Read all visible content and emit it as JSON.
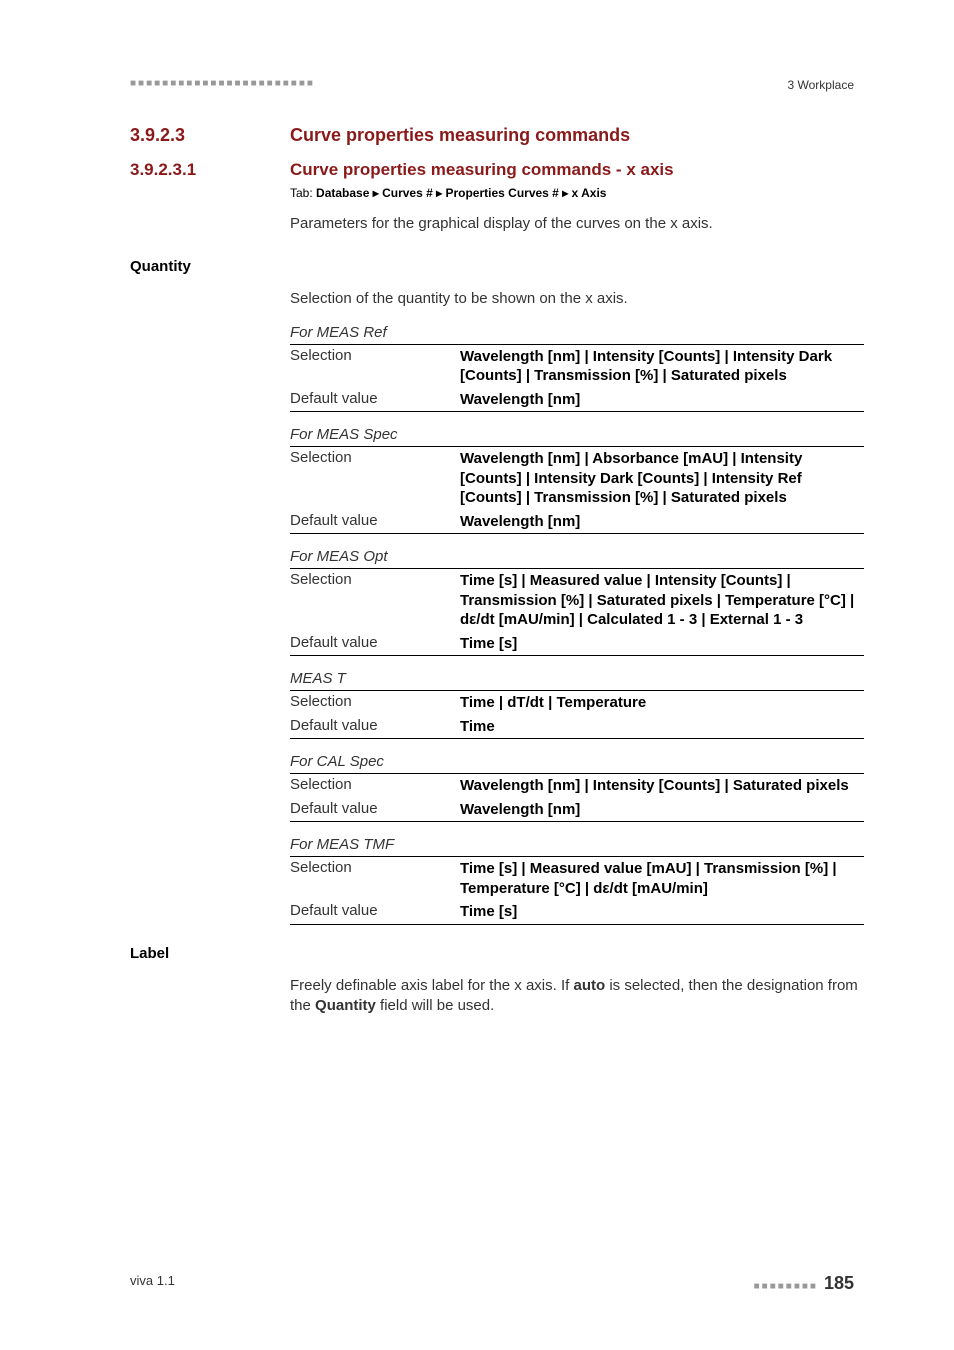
{
  "header": {
    "dots": "■■■■■■■■■■■■■■■■■■■■■■■",
    "right": "3 Workplace"
  },
  "section": {
    "num1": "3.9.2.3",
    "title1": "Curve properties measuring commands",
    "num2": "3.9.2.3.1",
    "title2": "Curve properties measuring commands - x axis"
  },
  "tabline": {
    "prefix": "Tab:",
    "text": "Database ▸ Curves # ▸ Properties Curves # ▸ x Axis"
  },
  "para1": "Parameters for the graphical display of the curves on the x axis.",
  "quantity": {
    "heading": "Quantity",
    "desc": "Selection of the quantity to be shown on the x axis."
  },
  "groups": [
    {
      "caption": "For MEAS Ref",
      "rows": [
        {
          "label": "Selection",
          "value": "Wavelength [nm] | Intensity [Counts] | Intensity Dark [Counts] | Transmission [%] | Saturated pixels"
        },
        {
          "label": "Default value",
          "value": "Wavelength [nm]"
        }
      ]
    },
    {
      "caption": "For MEAS Spec",
      "rows": [
        {
          "label": "Selection",
          "value": "Wavelength [nm] | Absorbance [mAU] | Intensity [Counts] | Intensity Dark [Counts] | Intensity Ref [Counts] | Transmission [%] | Saturated pixels"
        },
        {
          "label": "Default value",
          "value": "Wavelength [nm]"
        }
      ]
    },
    {
      "caption": "For MEAS Opt",
      "rows": [
        {
          "label": "Selection",
          "value": "Time [s] | Measured value | Intensity [Counts] | Transmission [%] | Saturated pixels | Temperature [°C] | dε/dt [mAU/min] | Calculated 1 - 3 | External 1 - 3"
        },
        {
          "label": "Default value",
          "value": "Time [s]"
        }
      ]
    },
    {
      "caption": "MEAS T",
      "rows": [
        {
          "label": "Selection",
          "value": "Time | dT/dt | Temperature"
        },
        {
          "label": "Default value",
          "value": "Time"
        }
      ]
    },
    {
      "caption": "For CAL Spec",
      "rows": [
        {
          "label": "Selection",
          "value": "Wavelength [nm] | Intensity [Counts] | Saturated pixels"
        },
        {
          "label": "Default value",
          "value": "Wavelength [nm]"
        }
      ]
    },
    {
      "caption": "For MEAS TMF",
      "rows": [
        {
          "label": "Selection",
          "value": "Time [s] | Measured value [mAU] | Transmission [%] | Temperature [°C] | dε/dt [mAU/min]"
        },
        {
          "label": "Default value",
          "value": "Time [s]"
        }
      ]
    }
  ],
  "label": {
    "heading": "Label",
    "text_pre": "Freely definable axis label for the x axis. If ",
    "bold1": "auto",
    "text_mid": " is selected, then the designation from the ",
    "bold2": "Quantity",
    "text_post": " field will be used."
  },
  "footer": {
    "left": "viva 1.1",
    "dots": "■■■■■■■■",
    "page": "185"
  }
}
